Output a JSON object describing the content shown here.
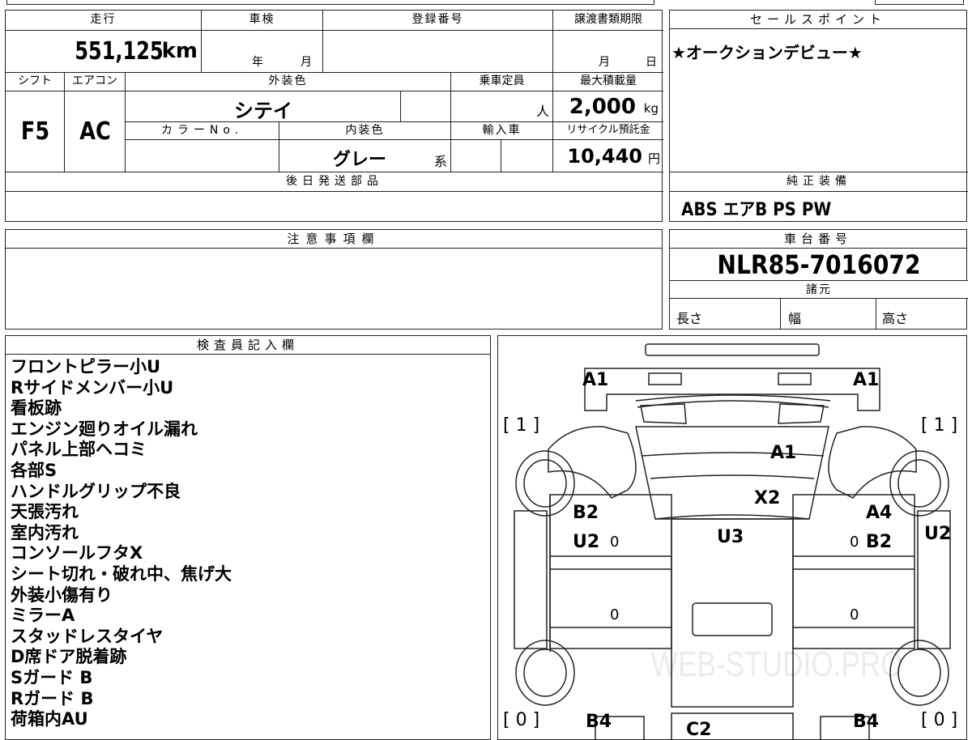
{
  "mileage": {
    "label": "走行",
    "value": "551,125",
    "unit": "km"
  },
  "inspection": {
    "label": "車検",
    "year_label": "年",
    "month_label": "月"
  },
  "registration": {
    "label": "登録番号",
    "value": ""
  },
  "transfer": {
    "label": "譲渡書類期限",
    "month_label": "月",
    "day_label": "日"
  },
  "shift": {
    "label": "シフト",
    "value": "F5"
  },
  "aircon": {
    "label": "エアコン",
    "value": "AC"
  },
  "exterior_color": {
    "label": "外装色",
    "value": "シテイ"
  },
  "capacity": {
    "label": "乗車定員",
    "value": "",
    "unit": "人"
  },
  "max_load": {
    "label": "最大積載量",
    "value": "2,000",
    "unit": "kg"
  },
  "color_no": {
    "label": "カラーNo.",
    "value": ""
  },
  "interior_color": {
    "label": "内装色",
    "value": "グレー",
    "suffix": "系"
  },
  "import": {
    "label": "輸入車",
    "value": ""
  },
  "recycle": {
    "label": "リサイクル預託金",
    "value": "10,440",
    "unit": "円"
  },
  "later_parts": {
    "label": "後日発送部品",
    "value": ""
  },
  "notes_caution": {
    "label": "注意事項欄",
    "value": ""
  },
  "sales_point": {
    "label": "セールスポイント",
    "value": "★オークションデビュー★"
  },
  "equipment": {
    "label": "純正装備",
    "value": "ABS エアB PS PW"
  },
  "chassis": {
    "label": "車台番号",
    "value": "NLR85-7016072"
  },
  "specs": {
    "label": "諸元",
    "length": "長さ",
    "width": "幅",
    "height": "高さ"
  },
  "inspector": {
    "label": "検査員記入欄",
    "lines": [
      "フロントピラー小U",
      "Rサイドメンバー小U",
      "看板跡",
      "エンジン廻りオイル漏れ",
      "パネル上部ヘコミ",
      "各部S",
      "ハンドルグリップ不良",
      "天張汚れ",
      "室内汚れ",
      "コンソールフタX",
      "シート切れ・破れ中、焦げ大",
      "外装小傷有り",
      "ミラーA",
      "スタッドレスタイヤ",
      "D席ドア脱着跡",
      "Sガード B",
      "Rガード B",
      "荷箱内AU"
    ]
  },
  "diagram": {
    "labels": {
      "a1_left": "A1",
      "a1_right": "A1",
      "a1_center": "A1",
      "x2": "X2",
      "b2_left": "B2",
      "u2_left": "U2",
      "u3": "U3",
      "a4": "A4",
      "b2_right": "B2",
      "u2_right": "U2",
      "b4_left": "B4",
      "b4_right": "B4",
      "c2": "C2",
      "tire_fl": "[ 1 ]",
      "tire_fr": "[ 1 ]",
      "tire_rl": "[ 0 ]",
      "tire_rr": "[ 0 ]",
      "z1": "0",
      "z2": "0",
      "z3": "0",
      "z4": "0"
    },
    "watermark": "WEB-STUDIO.PRO"
  }
}
